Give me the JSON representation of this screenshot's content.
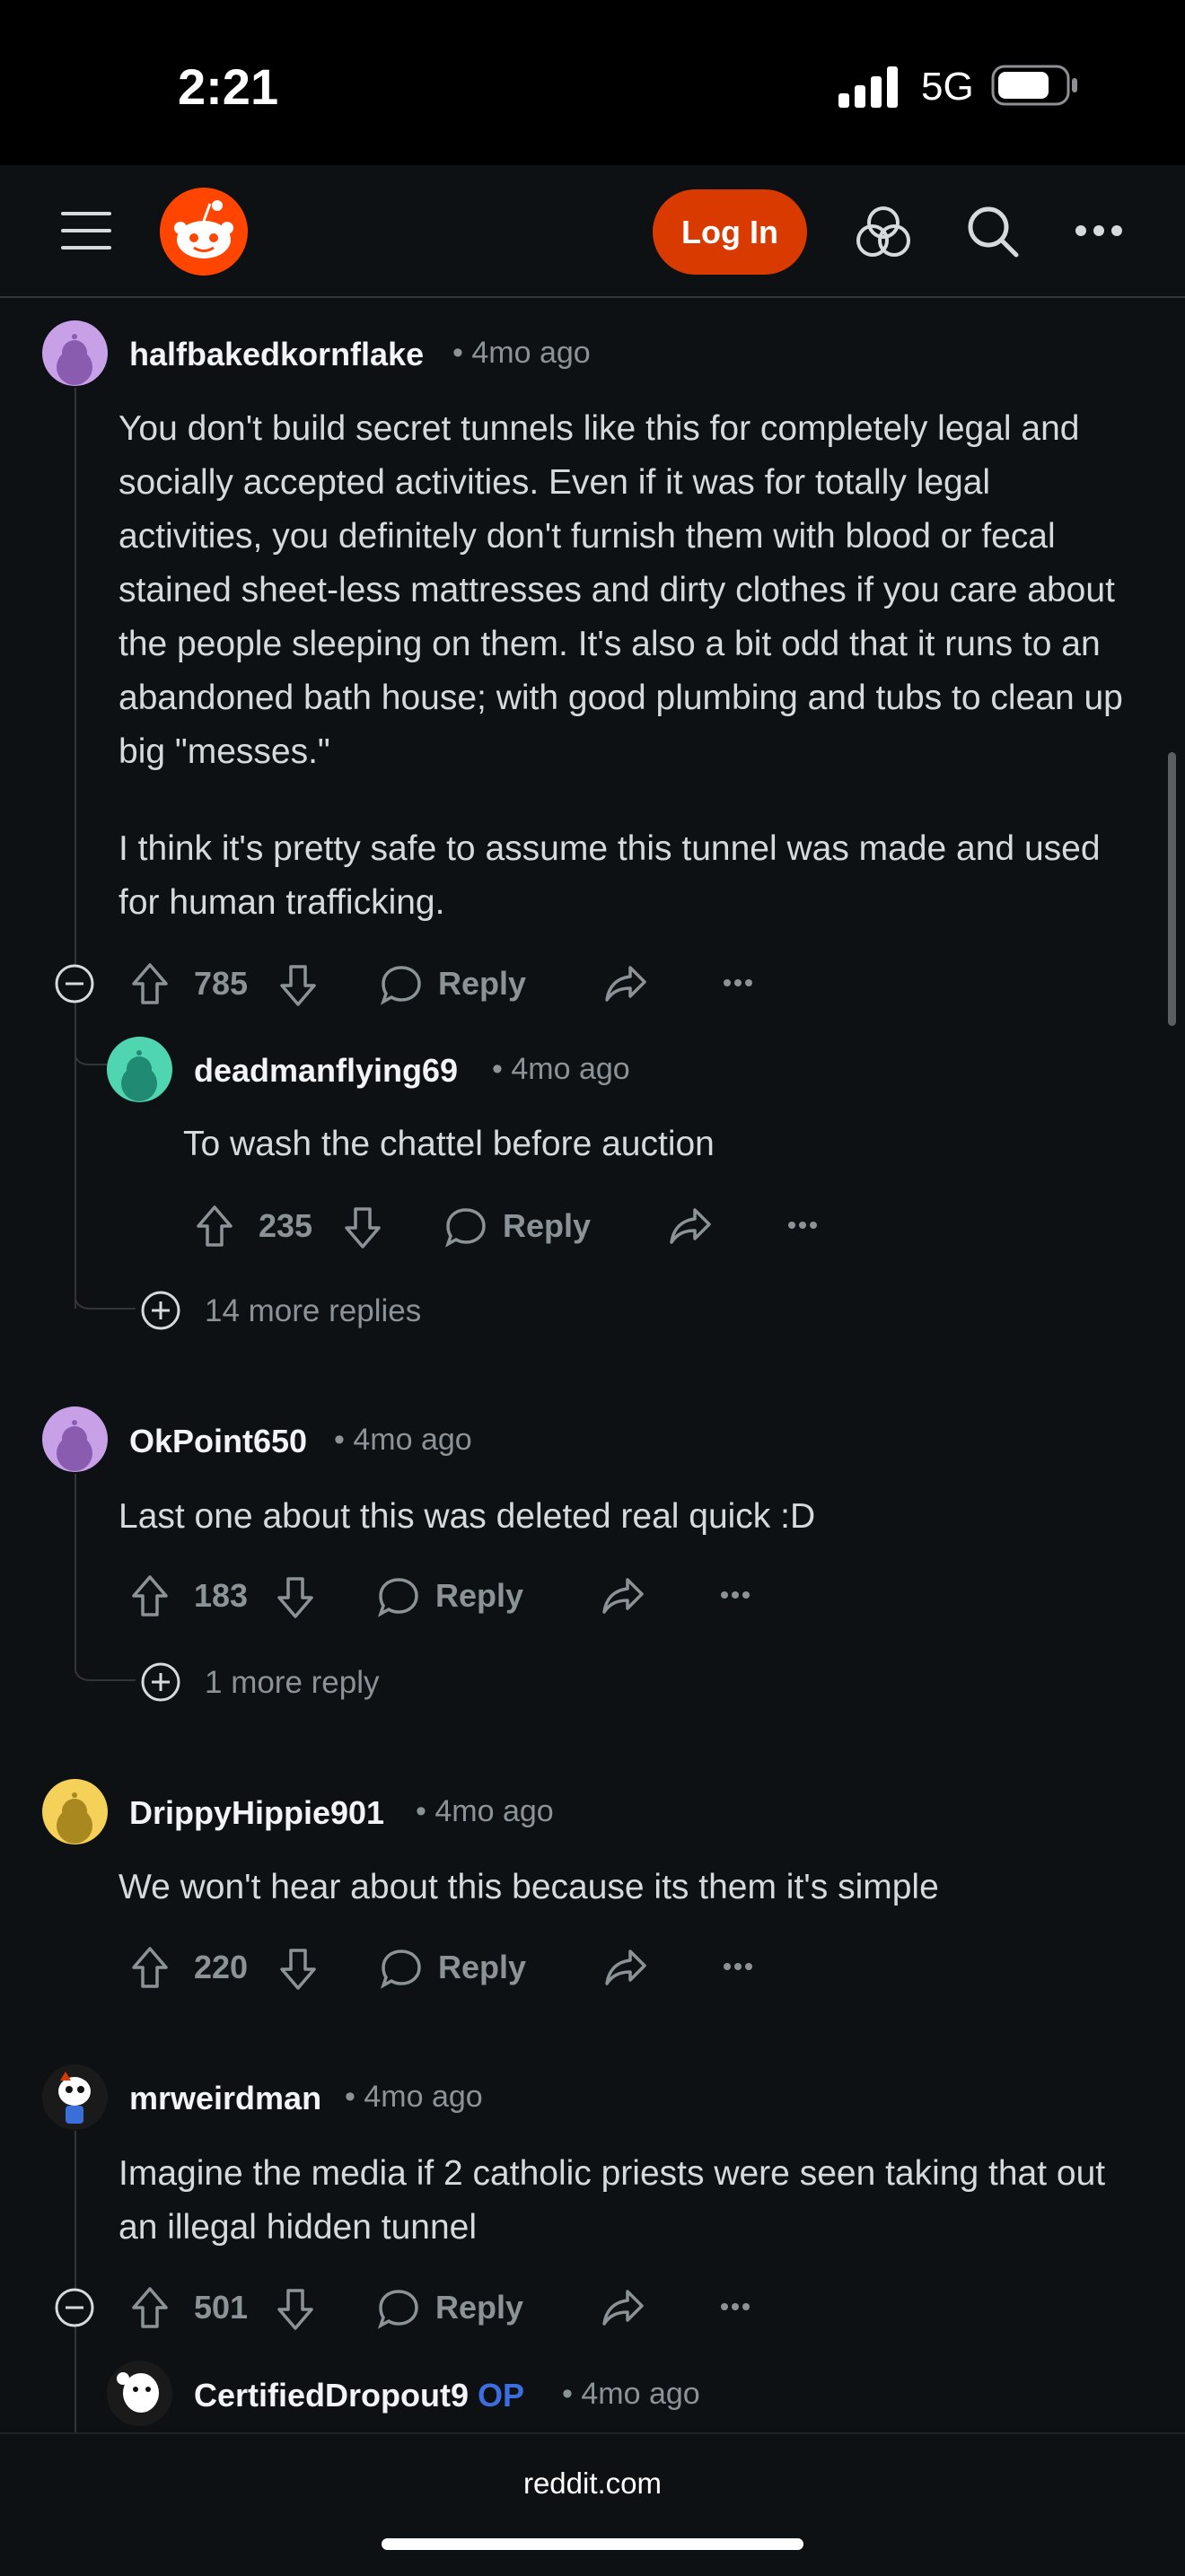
{
  "status": {
    "time": "2:21",
    "network": "5G"
  },
  "header": {
    "login_label": "Log In"
  },
  "comments": [
    {
      "user": "halfbakedkornflake",
      "age": "4mo ago",
      "paragraphs": [
        "You don't build secret tunnels like this for completely legal and socially accepted activities. Even if it was for totally legal activities, you definitely don't furnish them with blood or fecal stained sheet-less mattresses and dirty clothes if you care about the people sleeping on them. It's also a bit odd that it runs to an abandoned bath house; with good plumbing and tubs to clean up big \"messes.\"",
        "I think it's pretty safe to assume this tunnel was made and used for human trafficking."
      ],
      "votes": "785",
      "reply_label": "Reply"
    },
    {
      "user": "deadmanflying69",
      "age": "4mo ago",
      "text": "To wash the chattel before auction",
      "votes": "235",
      "reply_label": "Reply"
    },
    {
      "more_replies": "14 more replies"
    },
    {
      "user": "OkPoint650",
      "age": "4mo ago",
      "text": "Last one about this was deleted real quick :D",
      "votes": "183",
      "reply_label": "Reply"
    },
    {
      "more_replies": "1 more reply"
    },
    {
      "user": "DrippyHippie901",
      "age": "4mo ago",
      "text": "We won't hear about this because its them it's simple",
      "votes": "220",
      "reply_label": "Reply"
    },
    {
      "user": "mrweirdman",
      "age": "4mo ago",
      "text": "Imagine the media if 2 catholic priests were seen taking that out an illegal hidden tunnel",
      "votes": "501",
      "reply_label": "Reply"
    },
    {
      "user": "CertifiedDropout9",
      "op_badge": "OP",
      "age": "4mo ago"
    }
  ],
  "footer": {
    "url": "reddit.com"
  },
  "colors": {
    "background": "#0e1113",
    "login": "#d93a00",
    "op_badge": "#3c6ee0"
  }
}
